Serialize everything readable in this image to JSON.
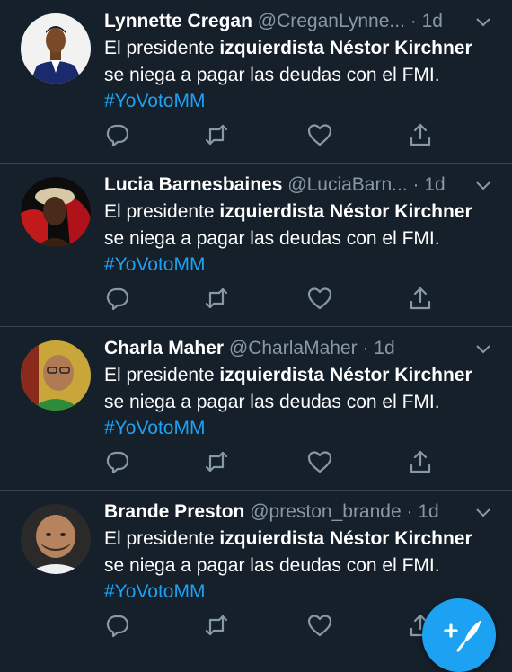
{
  "tweets": [
    {
      "name": "Lynnette Cregan",
      "handle": "@CreganLynne...",
      "dot": " · ",
      "time": "1d",
      "text_pre": "El presidente ",
      "text_bold1": "izquierdista Néstor Kirchner",
      "text_mid": " se niega a pagar las deudas con el FMI. ",
      "hashtag": "#YoVotoMM",
      "avatar": "avatar-man-suit"
    },
    {
      "name": "Lucia Barnesbaines",
      "handle": "@LuciaBarn...",
      "dot": " · ",
      "time": "1d",
      "text_pre": "El presidente ",
      "text_bold1": "izquierdista Néstor Kirchner",
      "text_mid": " se niega a pagar las deudas con el FMI. ",
      "hashtag": "#YoVotoMM",
      "avatar": "avatar-woman"
    },
    {
      "name": "Charla Maher",
      "handle": "@CharlaMaher",
      "dot": " · ",
      "time": "1d",
      "text_pre": "El presidente ",
      "text_bold1": "izquierdista Néstor Kirchner",
      "text_mid": " se niega a pagar las deudas con el FMI. ",
      "hashtag": "#YoVotoMM",
      "avatar": "avatar-man-glasses"
    },
    {
      "name": "Brande Preston",
      "handle": "@preston_brande",
      "dot": " · ",
      "time": "1d",
      "text_pre": "El presidente ",
      "text_bold1": "izquierdista Néstor Kirchner",
      "text_mid": " se niega a pagar las deudas con el FMI. ",
      "hashtag": "#YoVotoMM",
      "avatar": "avatar-man-bald"
    }
  ],
  "icons": {
    "reply": "reply-icon",
    "retweet": "retweet-icon",
    "like": "heart-icon",
    "share": "share-icon",
    "chevron": "chevron-down-icon",
    "compose": "compose-tweet-icon"
  },
  "colors": {
    "background": "#15202b",
    "divider": "#38444d",
    "secondary_text": "#8899a6",
    "accent": "#1da1f2"
  }
}
